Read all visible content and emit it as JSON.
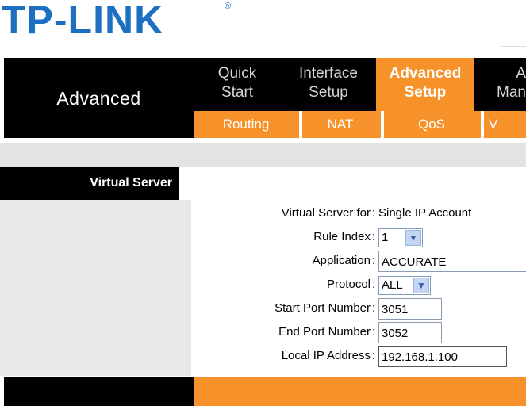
{
  "brand": {
    "logo_text": "TP-LINK",
    "registered_mark": "®",
    "logo_color": "#1d6fc2"
  },
  "header": {
    "section_title": "Advanced"
  },
  "nav": {
    "tabs": [
      {
        "line1": "Quick",
        "line2": "Start",
        "active": false
      },
      {
        "line1": "Interface",
        "line2": "Setup",
        "active": false
      },
      {
        "line1": "Advanced",
        "line2": "Setup",
        "active": true
      },
      {
        "line1": "A",
        "line2": "Man",
        "active": false
      }
    ],
    "subtabs": [
      "Routing",
      "NAT",
      "QoS",
      "V"
    ]
  },
  "panel": {
    "title": "Virtual Server"
  },
  "form": {
    "virtual_server_for": {
      "label": "Virtual Server for",
      "value": "Single IP Account"
    },
    "rule_index": {
      "label": "Rule Index",
      "value": "1"
    },
    "application": {
      "label": "Application",
      "value": "ACCURATE"
    },
    "protocol": {
      "label": "Protocol",
      "value": "ALL"
    },
    "start_port": {
      "label": "Start Port Number",
      "value": "3051"
    },
    "end_port": {
      "label": "End Port Number",
      "value": "3052"
    },
    "local_ip": {
      "label": "Local IP Address",
      "value": "192.168.1.100"
    },
    "colon": ":"
  },
  "colors": {
    "accent": "#f7922a",
    "dark": "#000000",
    "panel_grey": "#e8e8e8"
  },
  "icons": {
    "select_arrow": "chevron-down-icon"
  }
}
